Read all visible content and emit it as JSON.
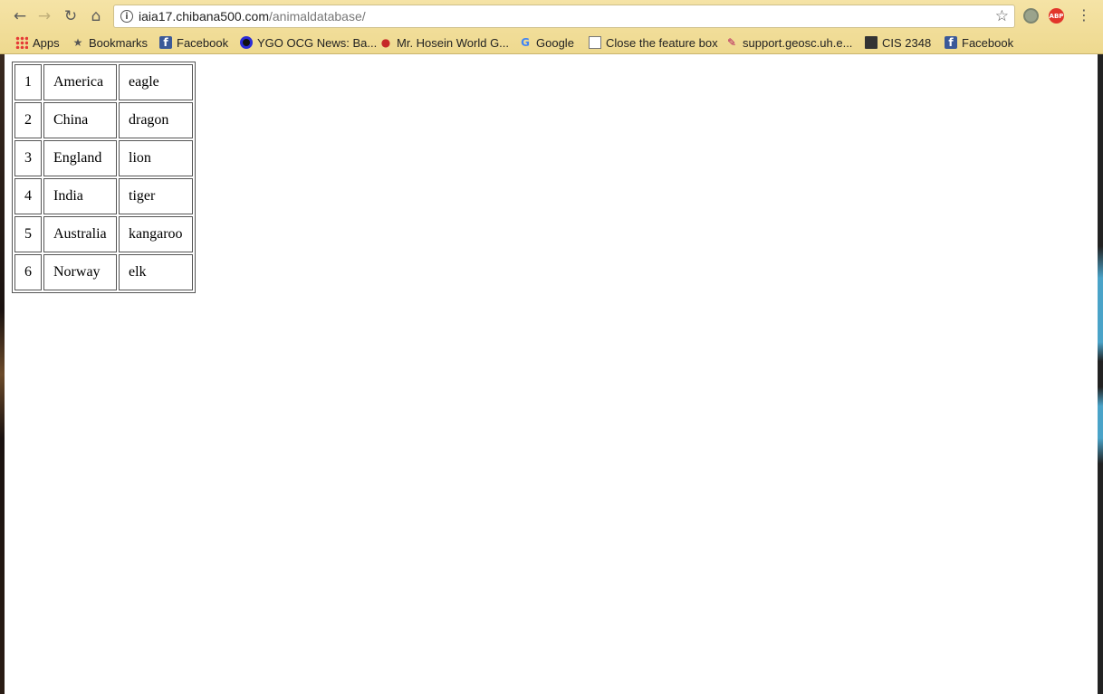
{
  "browser": {
    "url_host": "iaia17.chibana500.com",
    "url_path": "/animaldatabase/",
    "abp_label": "ABP"
  },
  "bookmarks": [
    {
      "label": "Apps",
      "icon": "apps-grid-icon"
    },
    {
      "label": "Bookmarks",
      "icon": "star-icon"
    },
    {
      "label": "Facebook",
      "icon": "facebook-icon"
    },
    {
      "label": "YGO OCG News: Ba...",
      "icon": "ygo-icon"
    },
    {
      "label": "Mr. Hosein World G...",
      "icon": "apple-icon"
    },
    {
      "label": "Google",
      "icon": "google-icon"
    },
    {
      "label": "Close the feature box",
      "icon": "page-icon"
    },
    {
      "label": "support.geosc.uh.e...",
      "icon": "feather-icon"
    },
    {
      "label": "CIS 2348",
      "icon": "book-icon"
    },
    {
      "label": "Facebook",
      "icon": "facebook-icon"
    }
  ],
  "table": {
    "rows": [
      [
        "1",
        "America",
        "eagle"
      ],
      [
        "2",
        "China",
        "dragon"
      ],
      [
        "3",
        "England",
        "lion"
      ],
      [
        "4",
        "India",
        "tiger"
      ],
      [
        "5",
        "Australia",
        "kangaroo"
      ],
      [
        "6",
        "Norway",
        "elk"
      ]
    ]
  }
}
